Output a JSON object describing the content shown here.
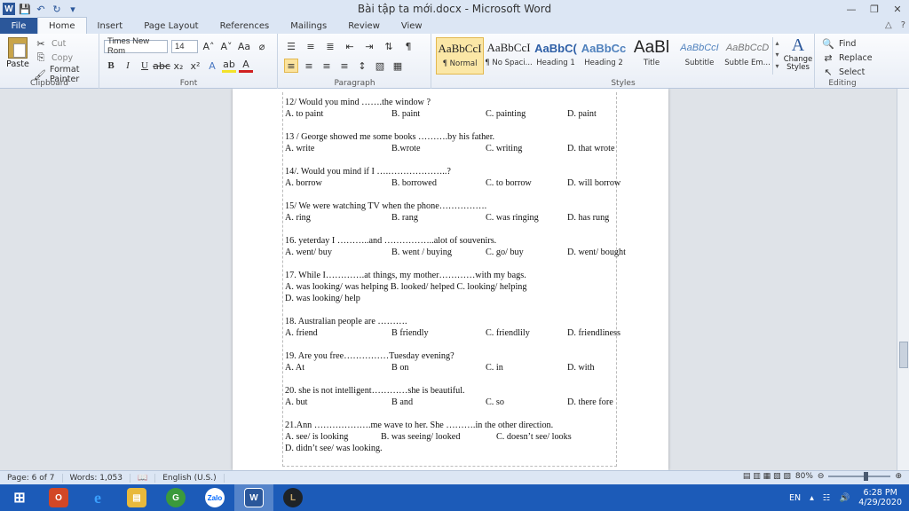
{
  "window": {
    "title": "Bài tập ta mới.docx - Microsoft Word"
  },
  "tabs": [
    "File",
    "Home",
    "Insert",
    "Page Layout",
    "References",
    "Mailings",
    "Review",
    "View"
  ],
  "ribbon": {
    "clipboard": {
      "label": "Clipboard",
      "paste": "Paste",
      "cut": "Cut",
      "copy": "Copy",
      "format_painter": "Format Painter"
    },
    "font": {
      "label": "Font",
      "family": "Times New Rom",
      "size": "14"
    },
    "paragraph": {
      "label": "Paragraph"
    },
    "styles": {
      "label": "Styles",
      "items": [
        {
          "preview": "AaBbCcI",
          "name": "¶ Normal"
        },
        {
          "preview": "AaBbCcI",
          "name": "¶ No Spaci..."
        },
        {
          "preview": "AaBbC(",
          "name": "Heading 1"
        },
        {
          "preview": "AaBbCc",
          "name": "Heading 2"
        },
        {
          "preview": "AaBl",
          "name": "Title"
        },
        {
          "preview": "AaBbCcI",
          "name": "Subtitle"
        },
        {
          "preview": "AaBbCcD",
          "name": "Subtle Em..."
        }
      ],
      "change_styles": "Change Styles"
    },
    "editing": {
      "label": "Editing",
      "find": "Find",
      "replace": "Replace",
      "select": "Select"
    }
  },
  "document": {
    "lines": [
      {
        "segments": [
          "12/ Would you mind …….the window ?"
        ]
      },
      {
        "segments": [
          "A. to paint",
          "B.  paint",
          "C. painting",
          "D. paint"
        ]
      },
      {
        "segments": [
          "13 / George showed me some books     ……….by his father."
        ]
      },
      {
        "segments": [
          "A. write",
          "B.wrote",
          "C. writing",
          "D.  that wrote"
        ]
      },
      {
        "segments": [
          "14/. Would you mind if I ….………………..?"
        ]
      },
      {
        "segments": [
          "A. borrow",
          "B. borrowed",
          "C. to borrow",
          "D. will borrow"
        ]
      },
      {
        "segments": [
          "15/ We were watching TV   when the phone……………."
        ]
      },
      {
        "segments": [
          "A. ring",
          "B. rang",
          "C. was ringing",
          "D. has rung"
        ]
      },
      {
        "segments": [
          "16. yeterday I ………..and ……………..alot of souvenirs."
        ]
      },
      {
        "segments": [
          "A. went/ buy",
          "B. went / buying",
          "C. go/ buy",
          "D. went/ bought"
        ]
      },
      {
        "segments": [
          "17. While I………….at things, my mother…………with my bags."
        ]
      },
      {
        "segments": [
          "A. was looking/ was helping  B. looked/ helped      C. looking/ helping"
        ]
      },
      {
        "segments": [
          "D. was looking/ help"
        ]
      },
      {
        "segments": [
          "18. Australian people are ………."
        ]
      },
      {
        "segments": [
          "A. friend",
          "B friendly",
          "C. friendlily",
          "D. friendliness"
        ]
      },
      {
        "segments": [
          "19. Are you free……………Tuesday evening?"
        ]
      },
      {
        "segments": [
          "A. At",
          "B on",
          "C. in",
          "D. with"
        ]
      },
      {
        "segments": [
          "20. she is not intelligent…………she is beautiful."
        ]
      },
      {
        "segments": [
          "A. but",
          "B and",
          "C. so",
          "D. there fore"
        ]
      },
      {
        "segments": [
          "21.Ann ……………….me wave to her. She ……….in the other direction."
        ]
      },
      {
        "segments": [
          "A. see/ is looking",
          "B. was seeing/ looked",
          "C. doesn’t see/ looks"
        ]
      },
      {
        "segments": [
          " D. didn’t see/ was looking."
        ]
      }
    ]
  },
  "status": {
    "page": "Page: 6 of 7",
    "words": "Words: 1,053",
    "language": "English (U.S.)",
    "zoom": "80%"
  },
  "taskbar": {
    "apps": [
      "start",
      "office",
      "ie",
      "explorer",
      "greenshot",
      "zalo",
      "word",
      "league"
    ],
    "lang": "EN",
    "time": "6:28 PM",
    "date": "4/29/2020"
  }
}
